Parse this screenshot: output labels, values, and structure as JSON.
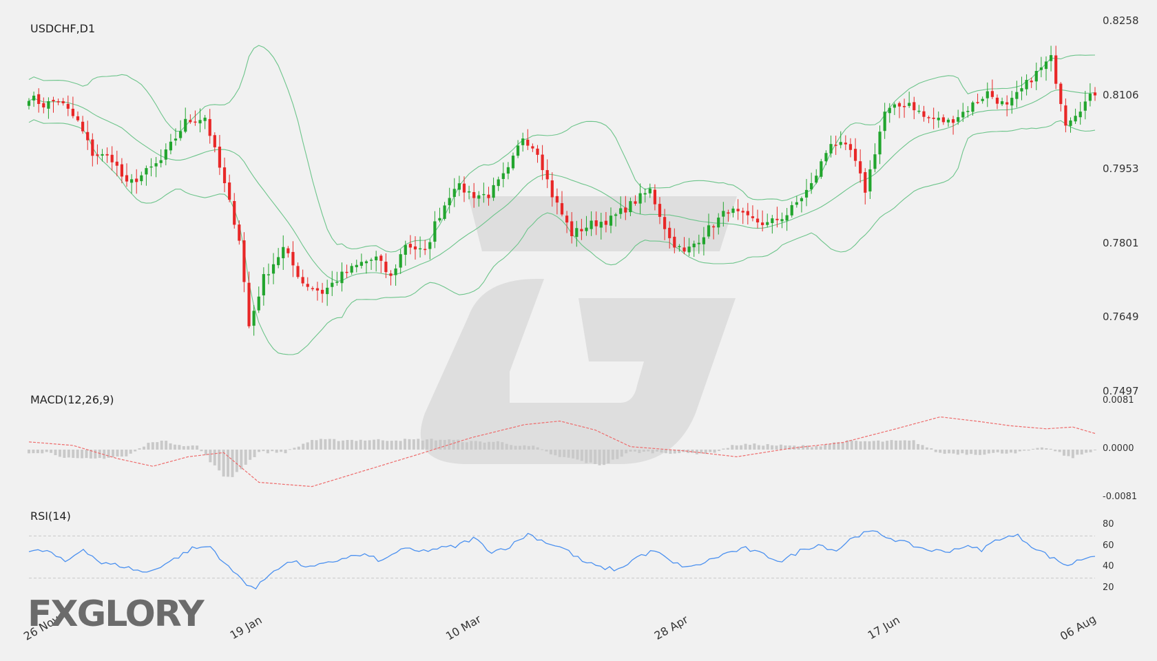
{
  "chart_data": {
    "type": "candlestick",
    "panels": {
      "price": {
        "title": "USDCHF,D1",
        "yticks": [
          "0.8258",
          "0.8106",
          "0.7953",
          "0.7801",
          "0.7649",
          "0.7497"
        ],
        "ylim": [
          0.7497,
          0.8258
        ],
        "overlay": "Bollinger Bands"
      },
      "macd": {
        "title": "MACD(12,26,9)",
        "yticks": [
          "0.0081",
          "0.0000",
          "-0.0081"
        ],
        "ylim": [
          -0.0081,
          0.0081
        ]
      },
      "rsi": {
        "title": "RSI(14)",
        "yticks": [
          "80",
          "60",
          "40",
          "20"
        ],
        "levels": [
          70,
          30
        ]
      }
    },
    "xticks": [
      "26 Nov",
      "19 Jan",
      "10 Mar",
      "28 Apr",
      "17 Jun",
      "06 Aug"
    ],
    "price_anchors": [
      [
        0,
        0.8102
      ],
      [
        3,
        0.8085
      ],
      [
        6,
        0.8095
      ],
      [
        10,
        0.805
      ],
      [
        13,
        0.7985
      ],
      [
        17,
        0.7975
      ],
      [
        20,
        0.792
      ],
      [
        23,
        0.794
      ],
      [
        27,
        0.797
      ],
      [
        32,
        0.805
      ],
      [
        36,
        0.806
      ],
      [
        40,
        0.792
      ],
      [
        43,
        0.781
      ],
      [
        45,
        0.763
      ],
      [
        48,
        0.773
      ],
      [
        52,
        0.779
      ],
      [
        56,
        0.772
      ],
      [
        60,
        0.77
      ],
      [
        64,
        0.7735
      ],
      [
        68,
        0.776
      ],
      [
        71,
        0.777
      ],
      [
        74,
        0.773
      ],
      [
        77,
        0.78
      ],
      [
        81,
        0.778
      ],
      [
        83,
        0.784
      ],
      [
        87,
        0.792
      ],
      [
        91,
        0.79
      ],
      [
        94,
        0.79
      ],
      [
        98,
        0.795
      ],
      [
        101,
        0.802
      ],
      [
        104,
        0.799
      ],
      [
        107,
        0.79
      ],
      [
        111,
        0.782
      ],
      [
        115,
        0.784
      ],
      [
        119,
        0.785
      ],
      [
        123,
        0.788
      ],
      [
        127,
        0.791
      ],
      [
        131,
        0.781
      ],
      [
        134,
        0.778
      ],
      [
        139,
        0.783
      ],
      [
        143,
        0.787
      ],
      [
        147,
        0.785
      ],
      [
        151,
        0.784
      ],
      [
        155,
        0.786
      ],
      [
        160,
        0.792
      ],
      [
        164,
        0.801
      ],
      [
        168,
        0.799
      ],
      [
        171,
        0.791
      ],
      [
        175,
        0.807
      ],
      [
        180,
        0.809
      ],
      [
        183,
        0.806
      ],
      [
        188,
        0.805
      ],
      [
        191,
        0.807
      ],
      [
        196,
        0.811
      ],
      [
        200,
        0.808
      ],
      [
        205,
        0.814
      ],
      [
        209,
        0.818
      ],
      [
        212,
        0.805
      ],
      [
        215,
        0.808
      ],
      [
        218,
        0.811
      ]
    ],
    "macd_anchors": [
      [
        0,
        0.0013
      ],
      [
        10,
        0.0007
      ],
      [
        20,
        -0.0015
      ],
      [
        28,
        -0.0028
      ],
      [
        36,
        -0.0012
      ],
      [
        44,
        -0.0005
      ],
      [
        52,
        -0.0055
      ],
      [
        64,
        -0.0062
      ],
      [
        76,
        -0.0035
      ],
      [
        88,
        -0.0008
      ],
      [
        100,
        0.002
      ],
      [
        112,
        0.0042
      ],
      [
        120,
        0.0048
      ],
      [
        128,
        0.0033
      ],
      [
        136,
        0.0005
      ],
      [
        148,
        -0.0002
      ],
      [
        160,
        -0.0012
      ],
      [
        172,
        0.0002
      ],
      [
        184,
        0.0012
      ],
      [
        196,
        0.0035
      ],
      [
        206,
        0.0055
      ],
      [
        214,
        0.0048
      ],
      [
        222,
        0.004
      ],
      [
        230,
        0.0035
      ],
      [
        236,
        0.0038
      ],
      [
        242,
        0.0025
      ]
    ],
    "rsi_anchors": [
      [
        0,
        55
      ],
      [
        4,
        56
      ],
      [
        8,
        45
      ],
      [
        12,
        58
      ],
      [
        16,
        44
      ],
      [
        20,
        42
      ],
      [
        26,
        35
      ],
      [
        32,
        48
      ],
      [
        36,
        58
      ],
      [
        40,
        60
      ],
      [
        44,
        40
      ],
      [
        48,
        25
      ],
      [
        50,
        20
      ],
      [
        54,
        38
      ],
      [
        58,
        46
      ],
      [
        62,
        40
      ],
      [
        66,
        44
      ],
      [
        70,
        50
      ],
      [
        74,
        52
      ],
      [
        78,
        46
      ],
      [
        82,
        58
      ],
      [
        86,
        55
      ],
      [
        90,
        58
      ],
      [
        94,
        60
      ],
      [
        98,
        68
      ],
      [
        102,
        55
      ],
      [
        106,
        60
      ],
      [
        110,
        72
      ],
      [
        114,
        64
      ],
      [
        118,
        58
      ],
      [
        122,
        46
      ],
      [
        126,
        40
      ],
      [
        130,
        38
      ],
      [
        134,
        50
      ],
      [
        138,
        56
      ],
      [
        142,
        44
      ],
      [
        146,
        40
      ],
      [
        150,
        47
      ],
      [
        154,
        54
      ],
      [
        158,
        58
      ],
      [
        162,
        52
      ],
      [
        166,
        46
      ],
      [
        170,
        56
      ],
      [
        174,
        62
      ],
      [
        178,
        56
      ],
      [
        182,
        70
      ],
      [
        186,
        74
      ],
      [
        190,
        68
      ],
      [
        194,
        62
      ],
      [
        198,
        57
      ],
      [
        202,
        55
      ],
      [
        206,
        60
      ],
      [
        210,
        57
      ],
      [
        214,
        68
      ],
      [
        218,
        70
      ],
      [
        222,
        58
      ],
      [
        226,
        48
      ],
      [
        229,
        42
      ],
      [
        232,
        48
      ],
      [
        235,
        52
      ]
    ]
  },
  "branding": {
    "logo_text": "FXGLORY"
  },
  "colors": {
    "bull": "#22a52e",
    "bear": "#e82727",
    "bands": "#6cc48a",
    "macd_signal": "#ee6a6a",
    "macd_hist": "#c9c9c9",
    "rsi_line": "#4a90f0",
    "rsi_levels": "#c8c8c8",
    "watermark": "#d9d9d9"
  }
}
